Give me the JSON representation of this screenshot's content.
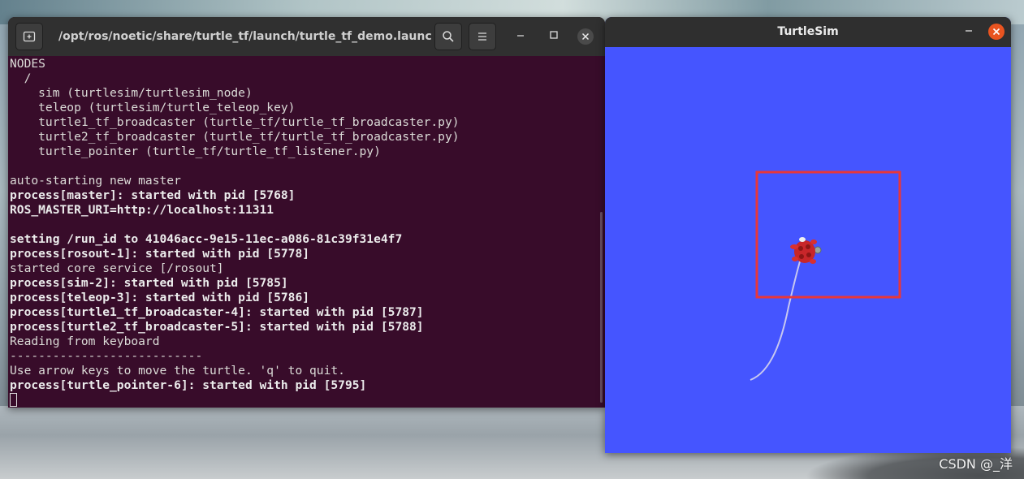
{
  "terminal": {
    "title": "/opt/ros/noetic/share/turtle_tf/launch/turtle_tf_demo.launch",
    "lines": [
      {
        "text": "NODES",
        "bold": false
      },
      {
        "text": "  /",
        "bold": false
      },
      {
        "text": "    sim (turtlesim/turtlesim_node)",
        "bold": false
      },
      {
        "text": "    teleop (turtlesim/turtle_teleop_key)",
        "bold": false
      },
      {
        "text": "    turtle1_tf_broadcaster (turtle_tf/turtle_tf_broadcaster.py)",
        "bold": false
      },
      {
        "text": "    turtle2_tf_broadcaster (turtle_tf/turtle_tf_broadcaster.py)",
        "bold": false
      },
      {
        "text": "    turtle_pointer (turtle_tf/turtle_tf_listener.py)",
        "bold": false
      },
      {
        "text": "",
        "bold": false
      },
      {
        "text": "auto-starting new master",
        "bold": false
      },
      {
        "text": "process[master]: started with pid [5768]",
        "bold": true
      },
      {
        "text": "ROS_MASTER_URI=http://localhost:11311",
        "bold": true
      },
      {
        "text": "",
        "bold": false
      },
      {
        "text": "setting /run_id to 41046acc-9e15-11ec-a086-81c39f31e4f7",
        "bold": true
      },
      {
        "text": "process[rosout-1]: started with pid [5778]",
        "bold": true
      },
      {
        "text": "started core service [/rosout]",
        "bold": false
      },
      {
        "text": "process[sim-2]: started with pid [5785]",
        "bold": true
      },
      {
        "text": "process[teleop-3]: started with pid [5786]",
        "bold": true
      },
      {
        "text": "process[turtle1_tf_broadcaster-4]: started with pid [5787]",
        "bold": true
      },
      {
        "text": "process[turtle2_tf_broadcaster-5]: started with pid [5788]",
        "bold": true
      },
      {
        "text": "Reading from keyboard",
        "bold": false
      },
      {
        "text": "---------------------------",
        "bold": false
      },
      {
        "text": "Use arrow keys to move the turtle. 'q' to quit.",
        "bold": false
      },
      {
        "text": "process[turtle_pointer-6]: started with pid [5795]",
        "bold": true
      }
    ]
  },
  "turtlesim": {
    "title": "TurtleSim",
    "background_color": "#4555ff",
    "highlight_color": "#e8373a"
  },
  "watermark": "CSDN @_洋",
  "icons": {
    "new_tab": "new-tab-icon",
    "search": "search-icon",
    "menu": "hamburger-menu-icon",
    "minimize": "minimize-icon",
    "maximize": "maximize-icon",
    "close": "close-icon"
  }
}
